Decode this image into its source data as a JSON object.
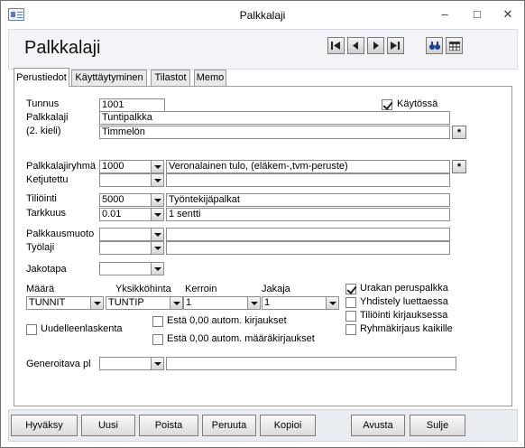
{
  "window": {
    "title": "Palkkalaji"
  },
  "header": {
    "title": "Palkkalaji"
  },
  "tabs": [
    "Perustiedot",
    "Käyttäytyminen",
    "Tilastot",
    "Memo"
  ],
  "fields": {
    "tunnus": {
      "label": "Tunnus",
      "value": "1001"
    },
    "kaytossa": {
      "label": "Käytössä",
      "checked": true
    },
    "palkkalaji": {
      "label": "Palkkalaji",
      "value": "Tuntipalkka"
    },
    "kieli2": {
      "label": "(2. kieli)",
      "value": "Timmelön"
    },
    "palkkalajiryhma": {
      "label": "Palkkalajiryhmä",
      "value": "1000",
      "desc": "Veronalainen tulo, (eläkem-,tvm-peruste)"
    },
    "ketjutettu": {
      "label": "Ketjutettu",
      "value": "",
      "desc": ""
    },
    "tiliointi": {
      "label": "Tiliöinti",
      "value": "5000",
      "desc": "Työntekijäpalkat"
    },
    "tarkkuus": {
      "label": "Tarkkuus",
      "value": "0.01",
      "desc": "1 sentti"
    },
    "palkkausmuoto": {
      "label": "Palkkausmuoto",
      "value": "",
      "desc": ""
    },
    "tyolaji": {
      "label": "Työlaji",
      "value": "",
      "desc": ""
    },
    "jakotapa": {
      "label": "Jakotapa",
      "value": ""
    },
    "maara": {
      "label": "Määrä",
      "value": "TUNNIT"
    },
    "yksikkohinta": {
      "label": "Yksikköhinta",
      "value": "TUNTIP"
    },
    "kerroin": {
      "label": "Kerroin",
      "value": "1"
    },
    "jakaja": {
      "label": "Jakaja",
      "value": "1"
    },
    "generoitava": {
      "label": "Generoitava pl",
      "value": ""
    }
  },
  "checks": {
    "uudelleenlaskenta": {
      "label": "Uudelleenlaskenta",
      "checked": false
    },
    "esta_kirjaukset": {
      "label": "Estä 0,00 autom. kirjaukset",
      "checked": false
    },
    "esta_maarakirjaukset": {
      "label": "Estä 0,00 autom. määräkirjaukset",
      "checked": false
    },
    "urakan_peruspalkka": {
      "label": "Urakan peruspalkka",
      "checked": true
    },
    "yhdistely": {
      "label": "Yhdistely luettaessa",
      "checked": false
    },
    "tiliointi_kirjauksessa": {
      "label": "Tiliöinti kirjauksessa",
      "checked": false
    },
    "ryhmakirjaus": {
      "label": "Ryhmäkirjaus kaikille",
      "checked": false
    }
  },
  "buttons": {
    "hyvaksy": "Hyväksy",
    "uusi": "Uusi",
    "poista": "Poista",
    "peruuta": "Peruuta",
    "kopioi": "Kopioi",
    "avusta": "Avusta",
    "sulje": "Sulje",
    "star": "*"
  },
  "icons": {
    "minimize": "minimize-icon",
    "maximize": "maximize-icon",
    "close": "close-icon"
  }
}
